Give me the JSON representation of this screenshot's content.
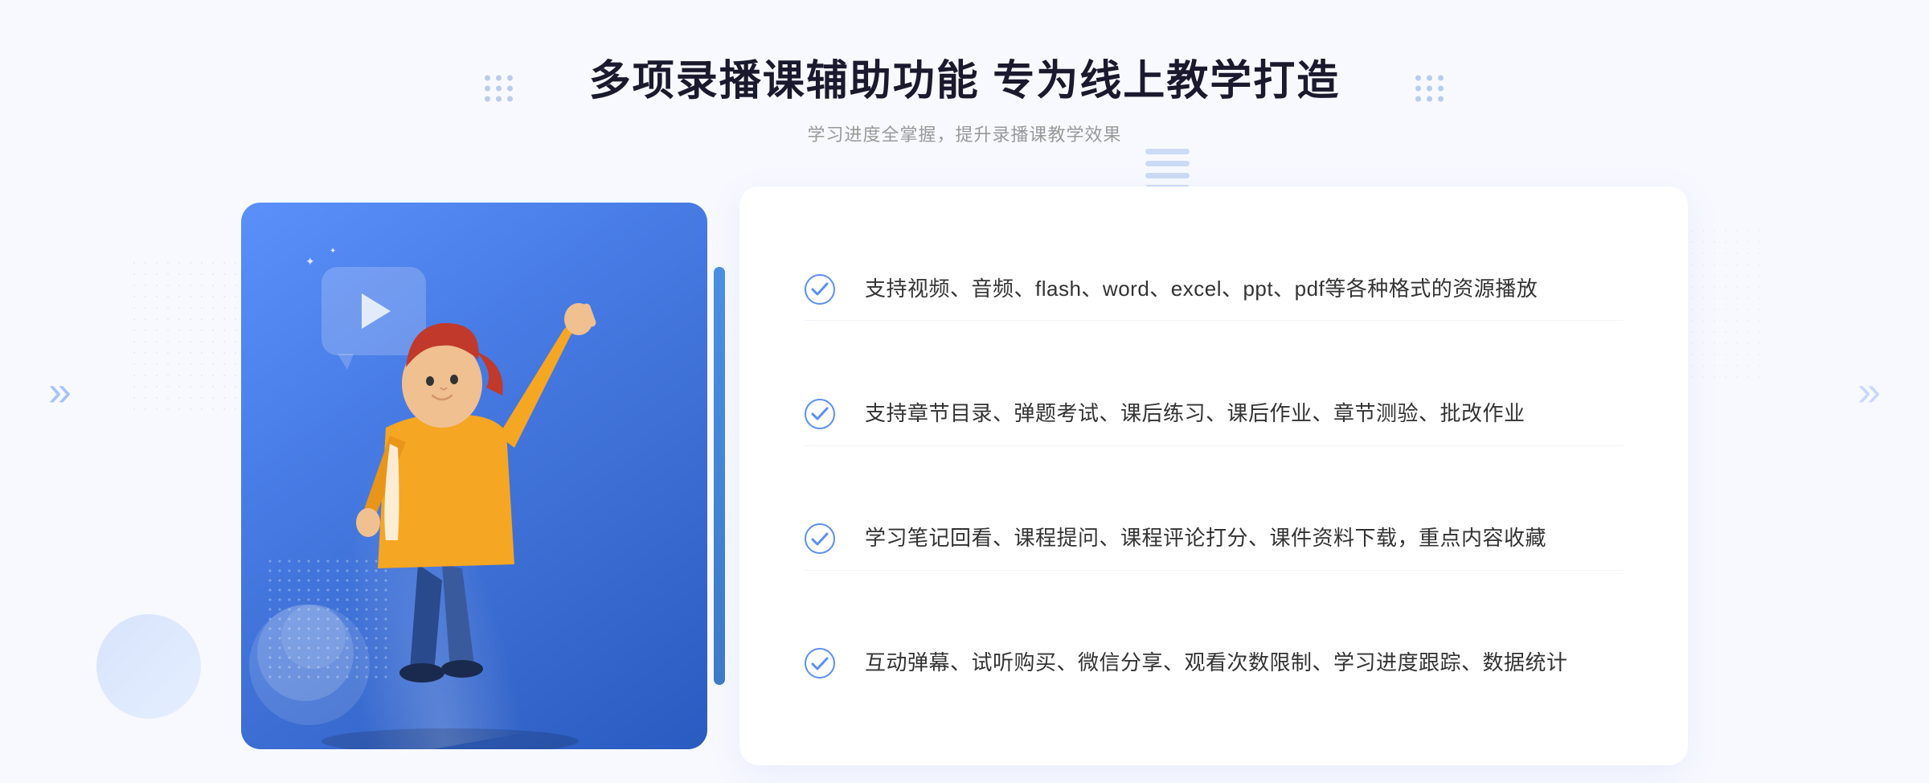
{
  "page": {
    "background_color": "#f5f7ff"
  },
  "header": {
    "main_title": "多项录播课辅助功能 专为线上教学打造",
    "sub_title": "学习进度全掌握，提升录播课教学效果",
    "decorative_dots_count": 9
  },
  "features": [
    {
      "id": 1,
      "text": "支持视频、音频、flash、word、excel、ppt、pdf等各种格式的资源播放"
    },
    {
      "id": 2,
      "text": "支持章节目录、弹题考试、课后练习、课后作业、章节测验、批改作业"
    },
    {
      "id": 3,
      "text": "学习笔记回看、课程提问、课程评论打分、课件资料下载，重点内容收藏"
    },
    {
      "id": 4,
      "text": "互动弹幕、试听购买、微信分享、观看次数限制、学习进度跟踪、数据统计"
    }
  ],
  "colors": {
    "primary_blue": "#4a7ef0",
    "light_blue": "#c5d5f0",
    "text_dark": "#222",
    "text_gray": "#999",
    "white": "#ffffff",
    "check_blue": "#5b8ff9"
  },
  "icons": {
    "check": "✓",
    "chevron_left": "«",
    "chevron_right": "»",
    "play": "▶"
  }
}
